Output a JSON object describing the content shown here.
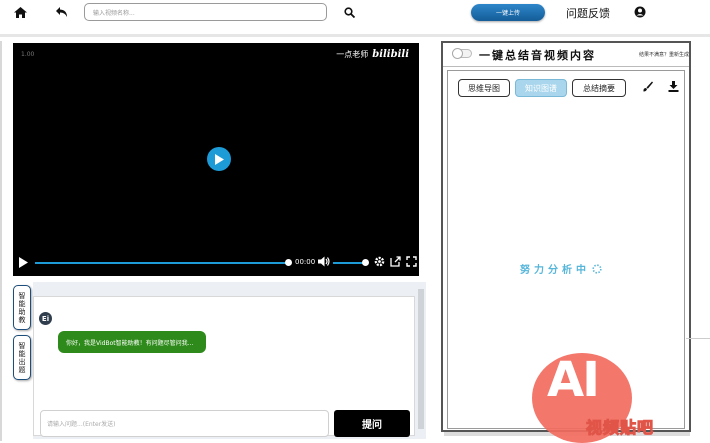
{
  "search": {
    "placeholder": "输入视频名称..."
  },
  "header": {
    "upload_label": "一键上传",
    "feedback_label": "问题反馈"
  },
  "video": {
    "time_top": "1.00",
    "author": "一点老师",
    "logo": "bilibili",
    "current_time": "00:00"
  },
  "side_tabs": {
    "assist": "智能助教",
    "quiz": "智能出题"
  },
  "chat": {
    "avatar_text": "Ei",
    "bot_message": "你好，我是VidBot智能助教！有问题尽管问我...",
    "input_placeholder": "请输入问题...(Enter发送)",
    "ask_label": "提问"
  },
  "summary": {
    "title": "一键总结音视频内容",
    "hint": "结果不满意？重新生成",
    "tabs": [
      "思维导图",
      "知识图谱",
      "总结摘要"
    ],
    "active_tab": "知识图谱",
    "loading": "努力分析中"
  },
  "watermark": {
    "ai": "AI",
    "text": "视频贴吧"
  }
}
